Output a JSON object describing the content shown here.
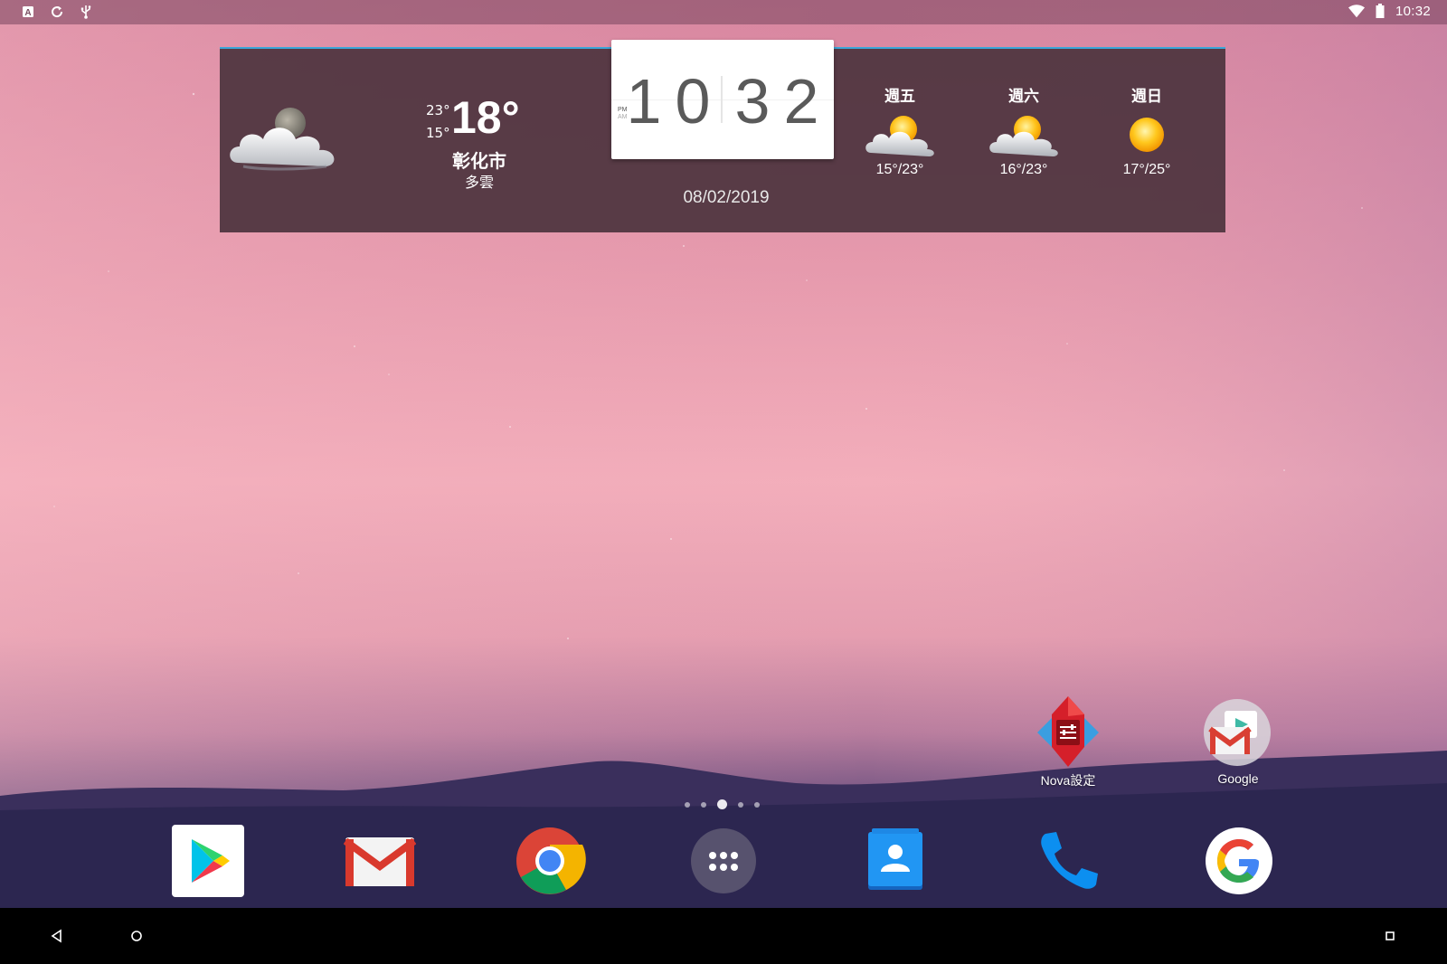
{
  "status_bar": {
    "time": "10:32",
    "left_icons": [
      "a-notification-icon",
      "sync-icon",
      "usb-icon"
    ],
    "right_icons": [
      "wifi-icon",
      "battery-icon"
    ]
  },
  "weather": {
    "high": "23°",
    "low": "15°",
    "current_temp": "18°",
    "city": "彰化市",
    "condition": "多雲",
    "date": "08/02/2019",
    "forecast": [
      {
        "day": "週五",
        "range": "15°/23°",
        "icon": "partly-cloudy-icon"
      },
      {
        "day": "週六",
        "range": "16°/23°",
        "icon": "partly-cloudy-icon"
      },
      {
        "day": "週日",
        "range": "17°/25°",
        "icon": "sun-icon"
      }
    ]
  },
  "clock": {
    "am_label": "AM",
    "pm_label": "PM",
    "hour_tens": "1",
    "hour_ones": "0",
    "min_tens": "3",
    "min_ones": "2"
  },
  "home_apps": [
    {
      "label": "Nova設定",
      "icon": "nova-settings-icon"
    },
    {
      "label": "Google",
      "icon": "google-folder-icon"
    }
  ],
  "dock": [
    {
      "name": "play-store",
      "icon": "play-store-icon"
    },
    {
      "name": "gmail",
      "icon": "gmail-icon"
    },
    {
      "name": "chrome",
      "icon": "chrome-icon"
    },
    {
      "name": "app-drawer",
      "icon": "app-drawer-icon"
    },
    {
      "name": "contacts",
      "icon": "contacts-icon"
    },
    {
      "name": "phone",
      "icon": "phone-icon"
    },
    {
      "name": "google",
      "icon": "google-icon"
    }
  ],
  "page_indicator": {
    "total": 5,
    "active": 3
  },
  "colors": {
    "widget_bg": "#503640",
    "widget_accent": "#3aa6d8",
    "nav_bar": "#000000"
  }
}
